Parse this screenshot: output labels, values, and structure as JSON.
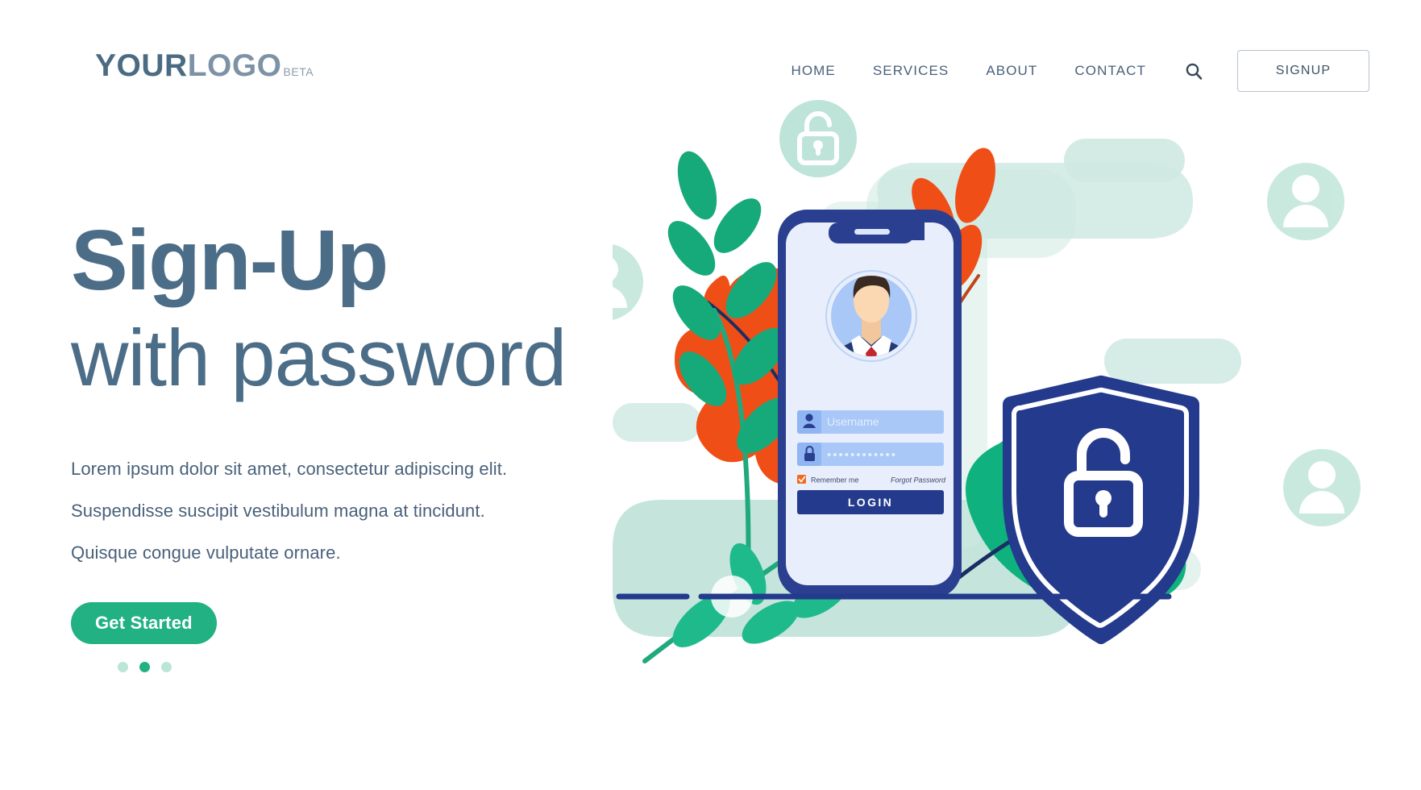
{
  "header": {
    "logo": {
      "part1": "YOUR",
      "part2": "LOGO",
      "badge": "BETA"
    },
    "nav": [
      {
        "label": "HOME",
        "name": "nav-home"
      },
      {
        "label": "SERVICES",
        "name": "nav-services"
      },
      {
        "label": "ABOUT",
        "name": "nav-about"
      },
      {
        "label": "CONTACT",
        "name": "nav-contact"
      }
    ],
    "search_icon": "search-icon",
    "signup_label": "SIGNUP"
  },
  "hero": {
    "headline_line1": "Sign-Up",
    "headline_line2": "with password",
    "paragraphs": [
      "Lorem ipsum dolor sit amet, consectetur adipiscing elit.",
      "Suspendisse suscipit vestibulum magna at tincidunt.",
      "Quisque congue vulputate ornare."
    ],
    "cta_label": "Get Started",
    "carousel": {
      "count": 3,
      "active_index": 1
    }
  },
  "illustration": {
    "phone": {
      "login_form": {
        "username_placeholder": "Username",
        "username_icon": "user-icon",
        "password_value": "••••••••••••",
        "password_icon": "lock-icon",
        "remember_me_label": "Remember me",
        "remember_me_checked": true,
        "forgot_password_label": "Forgot Password",
        "login_button_label": "LOGIN"
      },
      "avatar": "user-avatar-businessman"
    },
    "shield": {
      "icon": "open-padlock-icon"
    },
    "decor_icons": [
      {
        "type": "padlock-badge",
        "name": "decor-padlock-top"
      },
      {
        "type": "padlock-badge",
        "name": "decor-padlock-bottom-left"
      },
      {
        "type": "user-badge",
        "name": "decor-user-left"
      },
      {
        "type": "user-badge",
        "name": "decor-user-top-right"
      },
      {
        "type": "user-badge",
        "name": "decor-user-bottom-right"
      }
    ]
  },
  "colors": {
    "heading": "#4c6d87",
    "accent_green": "#22b183",
    "navy": "#243a8c",
    "orange": "#f04e17",
    "mint": "#b8e3d7",
    "screen_blue": "#e8eefc",
    "field_blue": "#a9c7f7"
  }
}
